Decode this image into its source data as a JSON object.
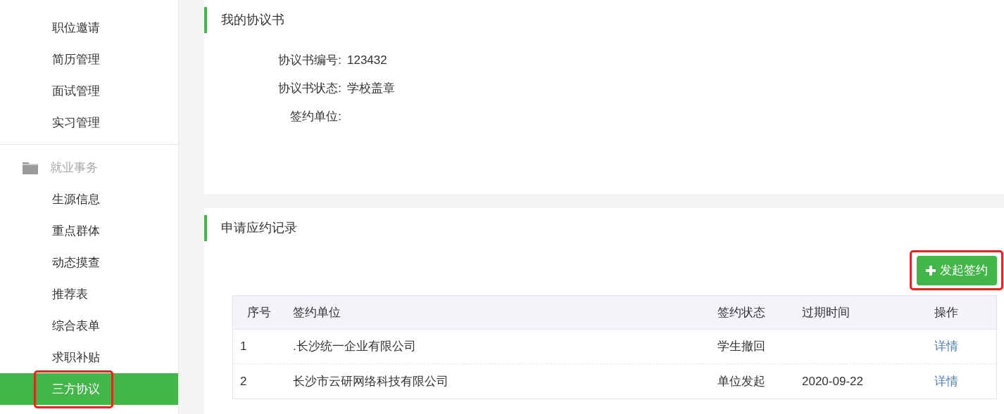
{
  "sidebar": {
    "sections": [
      {
        "items": [
          {
            "label": "职位邀请",
            "selected": false,
            "highlighted": false
          },
          {
            "label": "简历管理",
            "selected": false,
            "highlighted": false
          },
          {
            "label": "面试管理",
            "selected": false,
            "highlighted": false
          },
          {
            "label": "实习管理",
            "selected": false,
            "highlighted": false
          }
        ]
      },
      {
        "title": "就业事务",
        "items": [
          {
            "label": "生源信息",
            "selected": false,
            "highlighted": false
          },
          {
            "label": "重点群体",
            "selected": false,
            "highlighted": false
          },
          {
            "label": "动态摸查",
            "selected": false,
            "highlighted": false
          },
          {
            "label": "推荐表",
            "selected": false,
            "highlighted": false
          },
          {
            "label": "综合表单",
            "selected": false,
            "highlighted": false
          },
          {
            "label": "求职补贴",
            "selected": false,
            "highlighted": false
          },
          {
            "label": "三方协议",
            "selected": true,
            "highlighted": true
          }
        ]
      }
    ]
  },
  "agreement": {
    "title": "我的协议书",
    "fields": [
      {
        "label": "协议书编号:",
        "value": "123432"
      },
      {
        "label": "协议书状态:",
        "value": "学校盖章"
      },
      {
        "label": "签约单位:"
      }
    ]
  },
  "records": {
    "title": "申请应约记录",
    "button": {
      "label": "发起签约",
      "highlighted": true
    },
    "table": {
      "columns": [
        "序号",
        "签约单位",
        "签约状态",
        "过期时间",
        "操作"
      ],
      "rows": [
        {
          "cells": [
            "1",
            ".长沙统一企业有限公司",
            "学生撤回",
            ""
          ],
          "action": "详情"
        },
        {
          "cells": [
            "2",
            "长沙市云研网络科技有限公司",
            "单位发起",
            "2020-09-22"
          ],
          "action": "详情"
        }
      ]
    }
  }
}
